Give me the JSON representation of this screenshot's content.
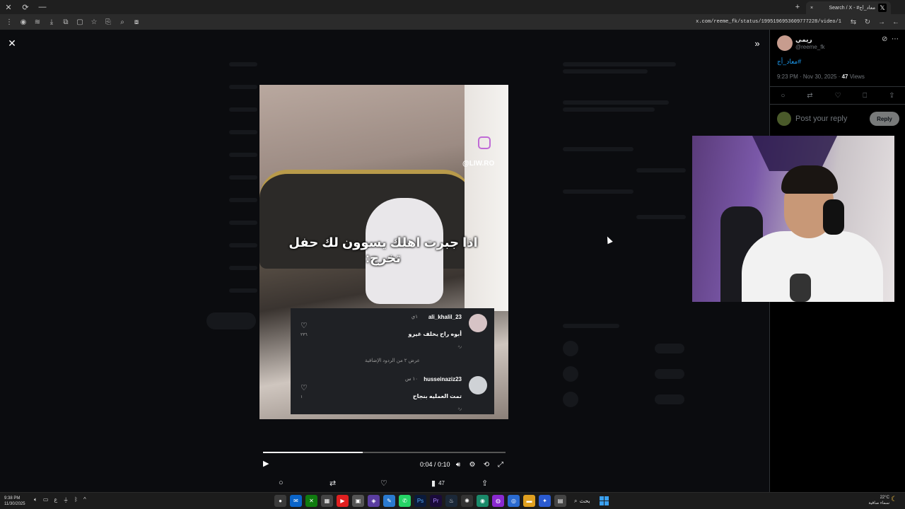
{
  "browser": {
    "tab_title": "Search / X - #معاد_أج",
    "tab_close": "×",
    "new_tab": "+",
    "address": "x.com/reeme_fk/status/1995196953609777228/video/1"
  },
  "video": {
    "watermark": "@LIW.RO",
    "caption": "اذا جبرت اهلك يسوون لك حفل تخرج:",
    "progress_percent": 41,
    "time": "0:04 / 0:10",
    "comments": [
      {
        "user": "ali_khalil_23",
        "time": "١ي",
        "text": "أبوه راح يخلف غيرو",
        "reply": "رد",
        "likes": "٢٣٦"
      },
      {
        "user": "husseinaziz23",
        "time": "١٠ س",
        "text": "تمت العمليه بنجاح",
        "reply": "رد",
        "likes": "١"
      }
    ],
    "more_replies": "عرض ٢ من الردود الإضافية"
  },
  "actions": {
    "views": "47"
  },
  "tweet": {
    "name": "ريمي",
    "handle": "@reeme_fk",
    "hashtag": "#معاد_أج",
    "time": "9:23 PM · Nov 30, 2025 · ",
    "views_count": "47",
    "views_label": " Views",
    "reply_placeholder": "Post your reply",
    "reply_button": "Reply"
  },
  "taskbar": {
    "time": "9:38 PM",
    "date": "11/30/2025",
    "search_label": "بحث",
    "temp": "22°C",
    "weather": "سماء صافية"
  },
  "colors": {
    "accent": "#1d9bf0",
    "background": "#000000"
  }
}
